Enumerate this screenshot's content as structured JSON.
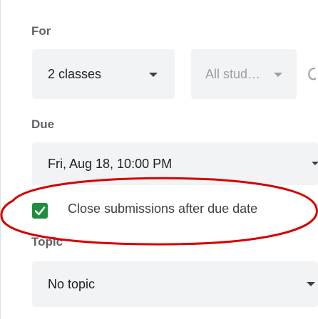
{
  "for_section": {
    "label": "For",
    "classes_value": "2 classes",
    "students_value": "All stud…"
  },
  "due_section": {
    "label": "Due",
    "due_value": "Fri, Aug 18, 10:00 PM"
  },
  "close_submissions": {
    "label": "Close submissions after due date",
    "checked": true
  },
  "topic_section": {
    "label": "Topic",
    "topic_value": "No topic"
  },
  "colors": {
    "field_bg": "#f1f3f4",
    "checkbox_green": "#1e8e3e",
    "annotation_red": "#d50000"
  }
}
